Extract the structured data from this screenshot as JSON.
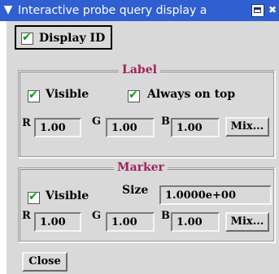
{
  "window": {
    "title": "Interactive probe query display a"
  },
  "display_id": {
    "label": "Display ID",
    "checked": true
  },
  "label_group": {
    "legend": "Label",
    "visible_label": "Visible",
    "visible_checked": true,
    "always_on_top_label": "Always on top",
    "always_on_top_checked": true,
    "r_label": "R",
    "r_value": "1.00",
    "g_label": "G",
    "g_value": "1.00",
    "b_label": "B",
    "b_value": "1.00",
    "mix_label": "Mix..."
  },
  "marker_group": {
    "legend": "Marker",
    "visible_label": "Visible",
    "visible_checked": true,
    "size_label": "Size",
    "size_value": "1.0000e+00",
    "r_label": "R",
    "r_value": "1.00",
    "g_label": "G",
    "g_value": "1.00",
    "b_label": "B",
    "b_value": "1.00",
    "mix_label": "Mix..."
  },
  "close_label": "Close",
  "colors": {
    "titlebar": "#2f5fd0",
    "legend_text": "#a0205a",
    "check": "#00a000",
    "panel": "#d9d9d9"
  }
}
